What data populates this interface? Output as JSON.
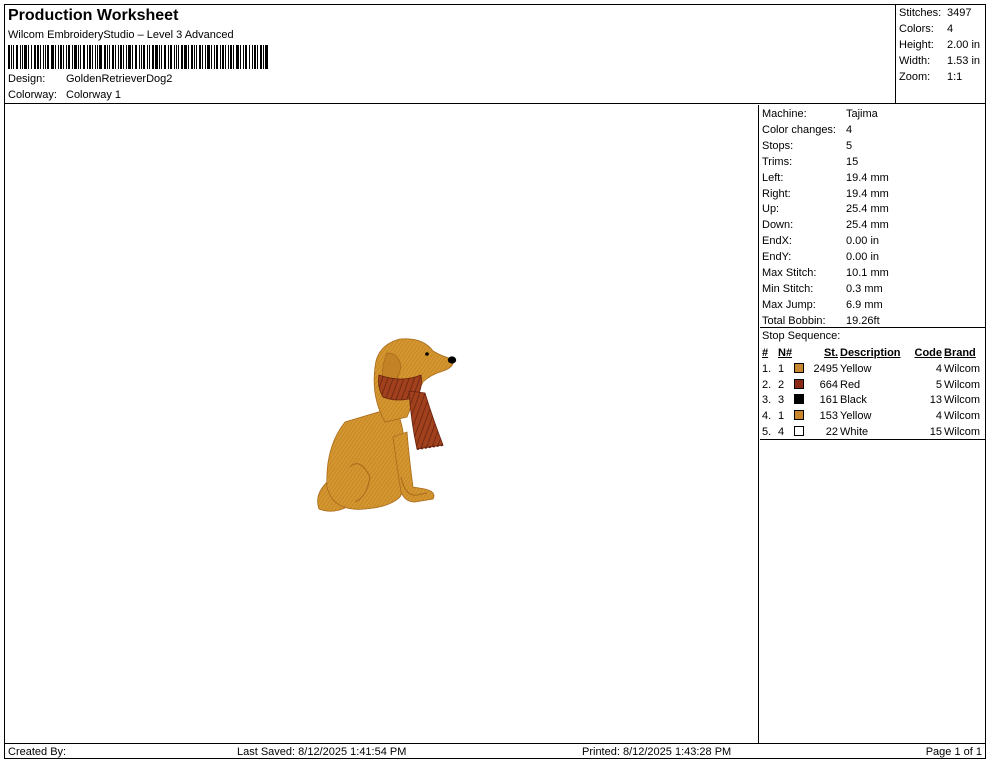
{
  "header": {
    "title": "Production Worksheet",
    "subtitle": "Wilcom EmbroideryStudio – Level 3 Advanced",
    "design_label": "Design:",
    "design_value": "GoldenRetrieverDog2",
    "colorway_label": "Colorway:",
    "colorway_value": "Colorway 1"
  },
  "summary": [
    {
      "key": "Stitches:",
      "value": "3497"
    },
    {
      "key": "Colors:",
      "value": "4"
    },
    {
      "key": "Height:",
      "value": "2.00 in"
    },
    {
      "key": "Width:",
      "value": "1.53 in"
    },
    {
      "key": "Zoom:",
      "value": "1:1"
    }
  ],
  "machine_info": [
    {
      "key": "Machine:",
      "value": "Tajima"
    },
    {
      "key": "Color changes:",
      "value": "4"
    },
    {
      "key": "Stops:",
      "value": "5"
    },
    {
      "key": "Trims:",
      "value": "15"
    },
    {
      "key": "Left:",
      "value": "19.4 mm"
    },
    {
      "key": "Right:",
      "value": "19.4 mm"
    },
    {
      "key": "Up:",
      "value": "25.4 mm"
    },
    {
      "key": "Down:",
      "value": "25.4 mm"
    },
    {
      "key": "EndX:",
      "value": "0.00 in"
    },
    {
      "key": "EndY:",
      "value": "0.00 in"
    },
    {
      "key": "Max Stitch:",
      "value": "10.1 mm"
    },
    {
      "key": "Min Stitch:",
      "value": "0.3 mm"
    },
    {
      "key": "Max Jump:",
      "value": "6.9 mm"
    },
    {
      "key": "Total Bobbin:",
      "value": "19.26ft"
    }
  ],
  "stop_sequence": {
    "title": "Stop Sequence:",
    "headers": [
      "#",
      "N#",
      "St.",
      "Description",
      "Code",
      "Brand"
    ],
    "rows": [
      {
        "num": "1.",
        "n": "1",
        "color": "#C8862E",
        "st": "2495",
        "desc": "Yellow",
        "code": "4",
        "brand": "Wilcom"
      },
      {
        "num": "2.",
        "n": "2",
        "color": "#8B2A14",
        "st": "664",
        "desc": "Red",
        "code": "5",
        "brand": "Wilcom"
      },
      {
        "num": "3.",
        "n": "3",
        "color": "#000000",
        "st": "161",
        "desc": "Black",
        "code": "13",
        "brand": "Wilcom"
      },
      {
        "num": "4.",
        "n": "1",
        "color": "#C8862E",
        "st": "153",
        "desc": "Yellow",
        "code": "4",
        "brand": "Wilcom"
      },
      {
        "num": "5.",
        "n": "4",
        "color": "#FFFFFF",
        "st": "22",
        "desc": "White",
        "code": "15",
        "brand": "Wilcom"
      }
    ]
  },
  "footer": {
    "created_by": "Created By:",
    "last_saved": "Last Saved: 8/12/2025 1:41:54 PM",
    "printed": "Printed: 8/12/2025 1:43:28 PM",
    "page": "Page 1 of 1"
  },
  "colors": {
    "dog_fur": "#D4962E",
    "dog_shadow": "#A86A1C",
    "scarf": "#A0401C",
    "scarf_stripe": "#6A2410",
    "nose": "#000000"
  }
}
